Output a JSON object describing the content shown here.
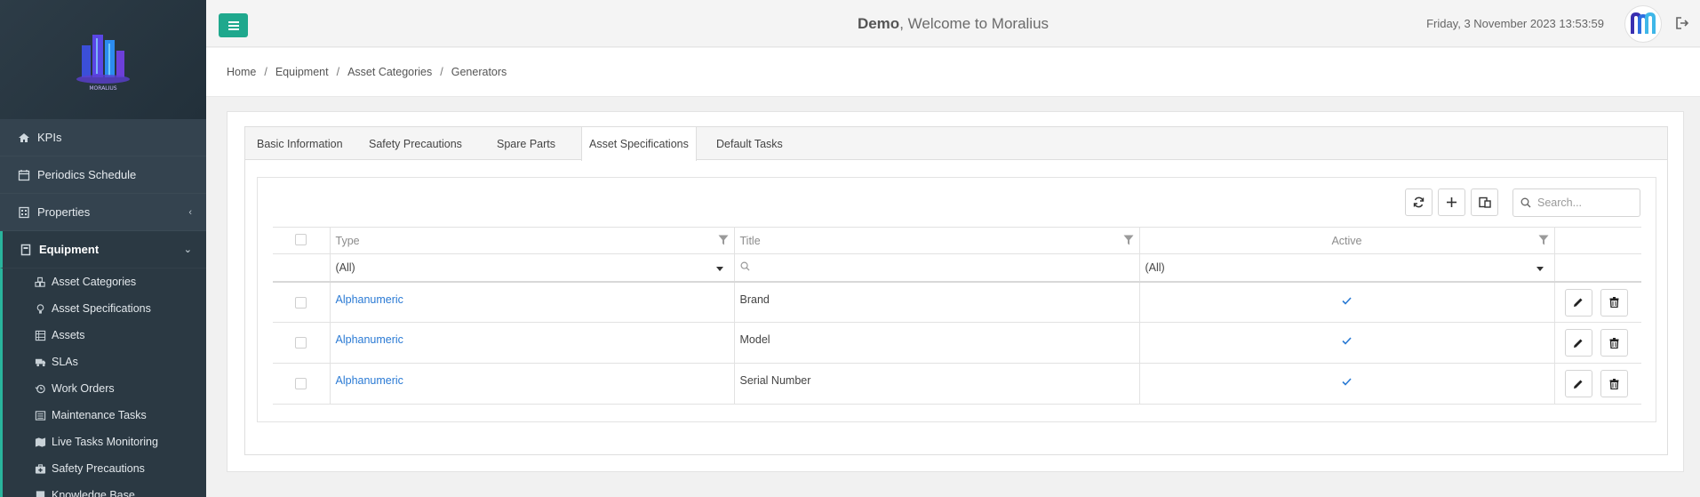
{
  "sidebar": {
    "logo_text": "MORALIUS",
    "items": [
      {
        "label": "KPIs",
        "icon": "home-icon"
      },
      {
        "label": "Periodics Schedule",
        "icon": "calendar-icon"
      },
      {
        "label": "Properties",
        "icon": "building-icon"
      },
      {
        "label": "Equipment",
        "icon": "equipment-icon"
      }
    ],
    "sub_items": [
      {
        "label": "Asset Categories",
        "icon": "cubes-icon"
      },
      {
        "label": "Asset Specifications",
        "icon": "lightbulb-icon"
      },
      {
        "label": "Assets",
        "icon": "grid-icon"
      },
      {
        "label": "SLAs",
        "icon": "truck-icon"
      },
      {
        "label": "Work Orders",
        "icon": "history-icon"
      },
      {
        "label": "Maintenance Tasks",
        "icon": "list-icon"
      },
      {
        "label": "Live Tasks Monitoring",
        "icon": "map-icon"
      },
      {
        "label": "Safety Precautions",
        "icon": "medkit-icon"
      },
      {
        "label": "Knowledge Base",
        "icon": "book-icon"
      }
    ]
  },
  "header": {
    "user": "Demo",
    "welcome_rest": ", Welcome to Moralius",
    "datetime": "Friday, 3 November 2023 13:53:59"
  },
  "breadcrumb": [
    "Home",
    "Equipment",
    "Asset Categories",
    "Generators"
  ],
  "tabs": [
    "Basic Information",
    "Safety Precautions",
    "Spare Parts",
    "Asset Specifications",
    "Default Tasks"
  ],
  "active_tab": "Asset Specifications",
  "grid": {
    "search_placeholder": "Search...",
    "columns": [
      "Type",
      "Title",
      "Active"
    ],
    "filters": {
      "type": "(All)",
      "active": "(All)"
    },
    "rows": [
      {
        "type": "Alphanumeric",
        "title": "Brand",
        "active": true
      },
      {
        "type": "Alphanumeric",
        "title": "Model",
        "active": true
      },
      {
        "type": "Alphanumeric",
        "title": "Serial Number",
        "active": true
      }
    ]
  },
  "colors": {
    "accent": "#1fa88d",
    "sidebar": "#34434f",
    "link": "#2a7ad4"
  }
}
